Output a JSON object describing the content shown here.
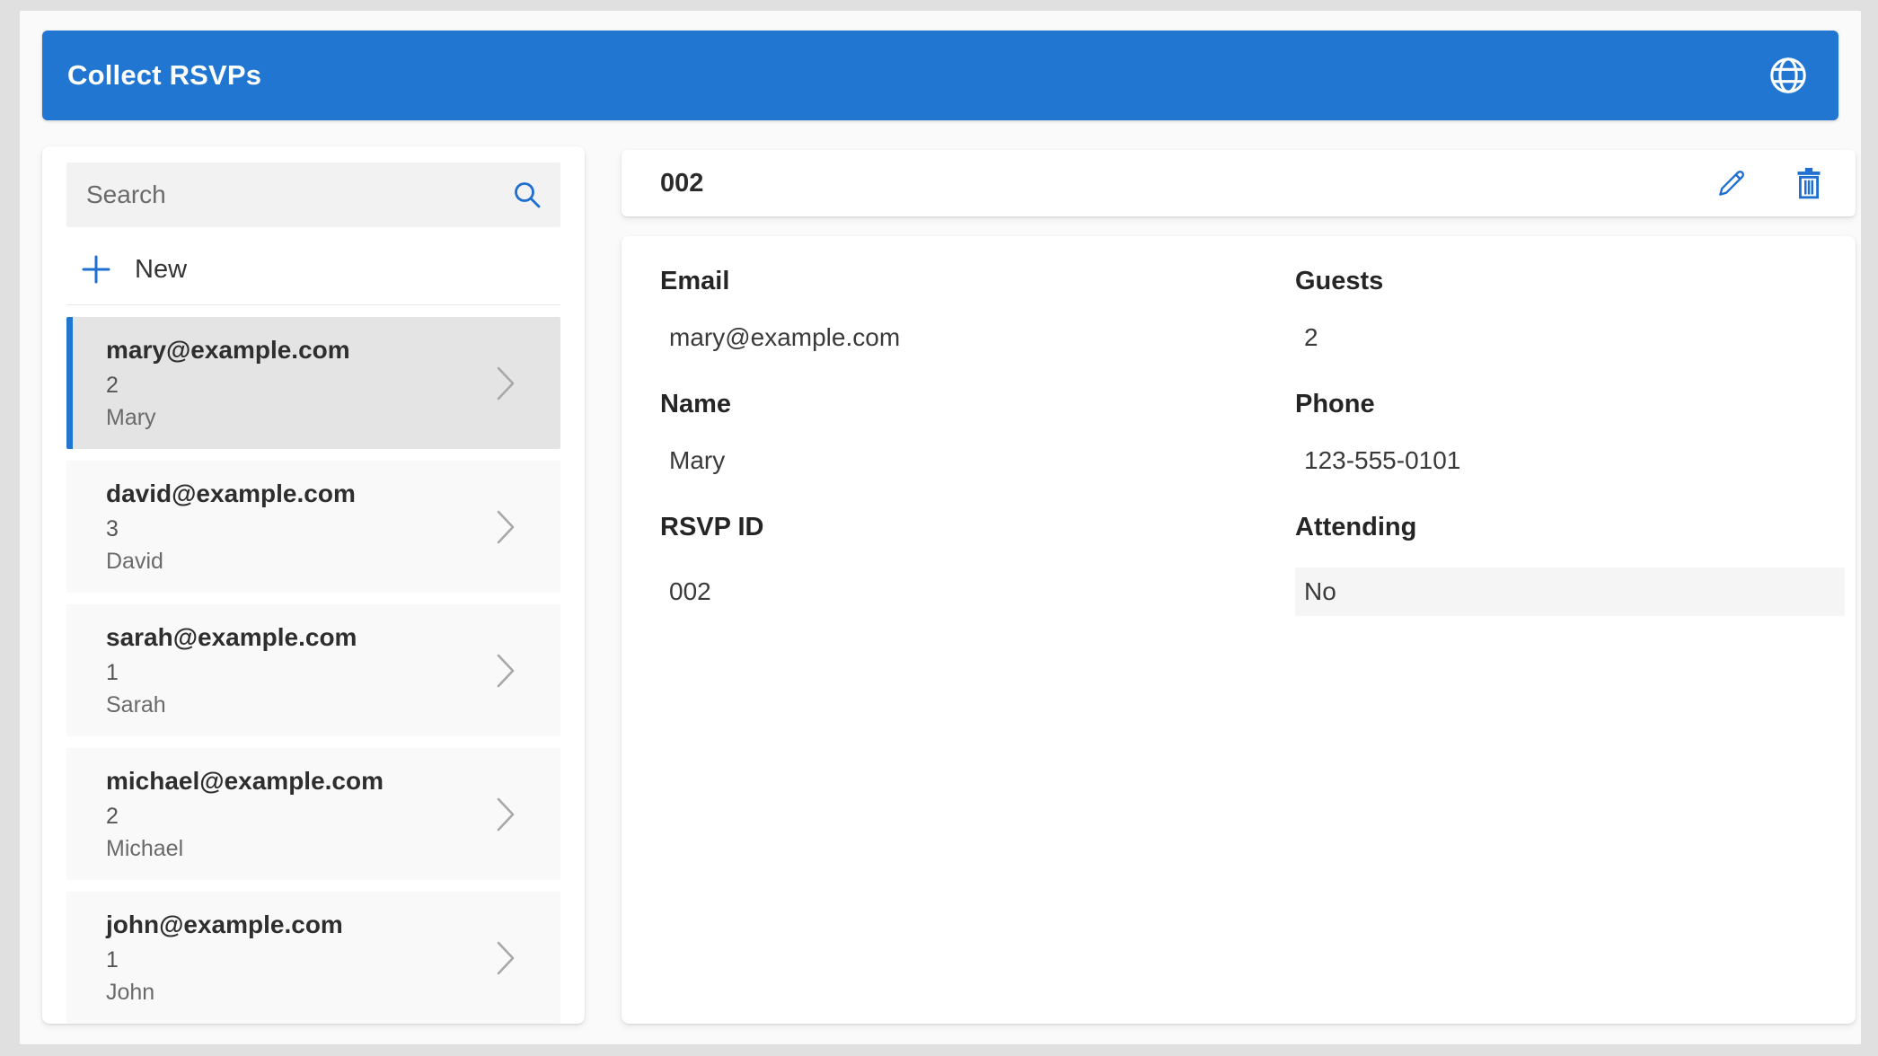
{
  "app": {
    "title": "Collect RSVPs"
  },
  "colors": {
    "accent_blue": "#2176d2",
    "header_background": "#2176d2",
    "selected_item_background": "#e4e4e4",
    "item_background": "#f9f9f9",
    "attending_value_background": "#f5f5f5",
    "canvas_background": "#fafafa",
    "frame_background": "#e0e0e0"
  },
  "sidebar": {
    "search_placeholder": "Search",
    "search_value": "",
    "new_label": "New",
    "items": [
      {
        "email": "mary@example.com",
        "guests": "2",
        "name": "Mary",
        "selected": true
      },
      {
        "email": "david@example.com",
        "guests": "3",
        "name": "David",
        "selected": false
      },
      {
        "email": "sarah@example.com",
        "guests": "1",
        "name": "Sarah",
        "selected": false
      },
      {
        "email": "michael@example.com",
        "guests": "2",
        "name": "Michael",
        "selected": false
      },
      {
        "email": "john@example.com",
        "guests": "1",
        "name": "John",
        "selected": false
      }
    ]
  },
  "detail": {
    "title": "002",
    "fields": [
      {
        "label": "Email",
        "value": "mary@example.com",
        "highlighted": false
      },
      {
        "label": "Guests",
        "value": "2",
        "highlighted": false
      },
      {
        "label": "Name",
        "value": "Mary",
        "highlighted": false
      },
      {
        "label": "Phone",
        "value": "123-555-0101",
        "highlighted": false
      },
      {
        "label": "RSVP ID",
        "value": "002",
        "highlighted": false
      },
      {
        "label": "Attending",
        "value": "No",
        "highlighted": true
      }
    ]
  },
  "icons": {
    "header_right": "globe-icon",
    "search": "search-icon",
    "new": "plus-icon",
    "list_item": "chevron-right-icon",
    "edit": "pencil-icon",
    "delete": "trash-icon"
  }
}
